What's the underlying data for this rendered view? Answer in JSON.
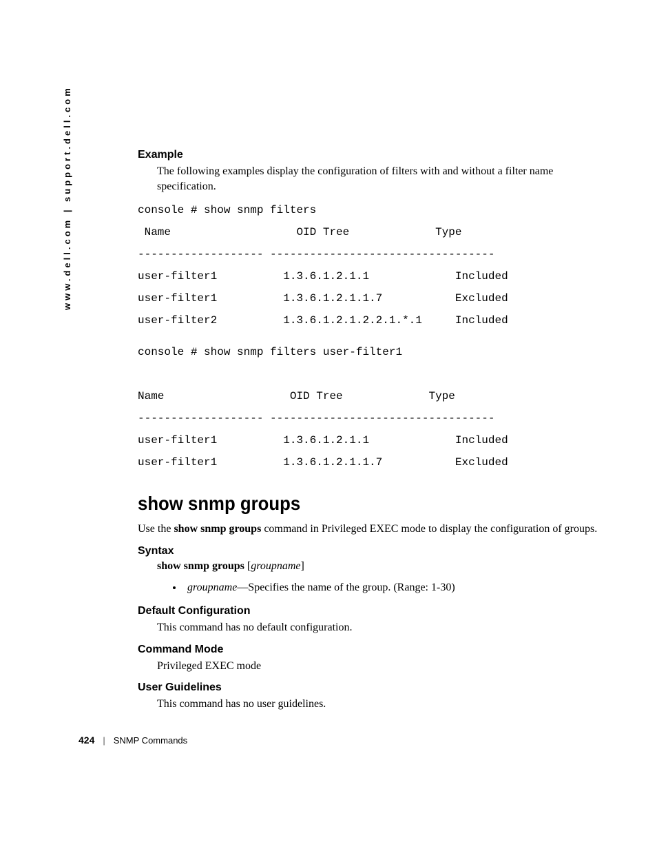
{
  "sidebar": "www.dell.com | support.dell.com",
  "example": {
    "label": "Example",
    "intro": "The following examples display the configuration of filters with and without a filter name specification.",
    "block1": "console # show snmp filters\n Name                   OID Tree             Type\n------------------- ----------------------------------\nuser-filter1          1.3.6.1.2.1.1             Included\nuser-filter1          1.3.6.1.2.1.1.7           Excluded\nuser-filter2          1.3.6.1.2.1.2.2.1.*.1     Included",
    "block2": "console # show snmp filters user-filter1\n\nName                   OID Tree             Type\n------------------- ----------------------------------\nuser-filter1          1.3.6.1.2.1.1             Included\nuser-filter1          1.3.6.1.2.1.1.7           Excluded"
  },
  "command": {
    "heading": "show snmp groups",
    "intro_pre": "Use the ",
    "intro_bold": "show snmp groups",
    "intro_post": " command in Privileged EXEC mode to display the configuration of groups."
  },
  "syntax": {
    "label": "Syntax",
    "bold": "show snmp groups",
    "bracket_open": " [",
    "ital": "groupname",
    "bracket_close": "]",
    "bullet_ital": "groupname",
    "bullet_rest": "—Specifies the name of the group. (Range: 1-30)"
  },
  "defaultcfg": {
    "label": "Default Configuration",
    "text": "This command has no default configuration."
  },
  "cmdmode": {
    "label": "Command Mode",
    "text": "Privileged EXEC mode"
  },
  "userguide": {
    "label": "User Guidelines",
    "text": "This command has no user guidelines."
  },
  "footer": {
    "page": "424",
    "divider": "|",
    "section": "SNMP Commands"
  }
}
